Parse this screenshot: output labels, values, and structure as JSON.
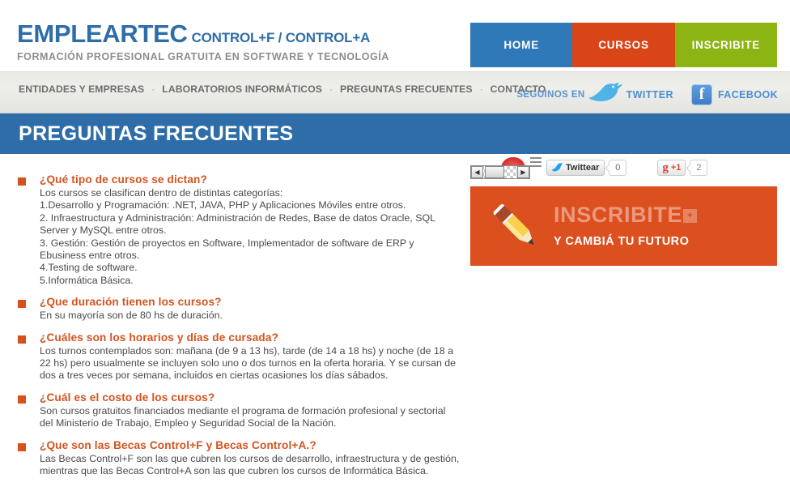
{
  "header": {
    "brand_main": "EMPLEARTEC",
    "brand_sub": "CONTROL+F / CONTROL+A",
    "tagline": "FORMACIÓN PROFESIONAL GRATUITA EN SOFTWARE Y TECNOLOGÍA",
    "nav": [
      {
        "label": "HOME",
        "color": "#3079b8"
      },
      {
        "label": "CURSOS",
        "color": "#da4518"
      },
      {
        "label": "INSCRIBITE",
        "color": "#8cb513"
      }
    ]
  },
  "subnav": {
    "links": [
      "ENTIDADES Y EMPRESAS",
      "LABORATORIOS INFORMÁTICOS",
      "PREGUNTAS FRECUENTES",
      "CONTACTO"
    ],
    "separator": "·",
    "social": {
      "follow_label": "SEGUINOS EN",
      "twitter_label": "TWITTER",
      "facebook_label": "FACEBOOK",
      "facebook_glyph": "f"
    }
  },
  "page": {
    "title": "PREGUNTAS FRECUENTES",
    "title_bar_color": "#2e6da8"
  },
  "faq": {
    "accent_color": "#d5521d",
    "items": [
      {
        "question": "¿Qué tipo de cursos se dictan?",
        "answer": "Los cursos se clasifican dentro de distintas categorías:\n1.Desarrollo y Programación: .NET, JAVA, PHP y Aplicaciones Móviles entre otros.\n2. Infraestructura y Administración: Administración de Redes, Base de datos Oracle, SQL Server y MySQL entre otros.\n3. Gestión: Gestión de proyectos en Software, Implementador de software de ERP y Ebusiness entre otros.\n4.Testing de software.\n5.Informática Básica."
      },
      {
        "question": "¿Que duración tienen los cursos?",
        "answer": "En su mayoría son de 80 hs de duración."
      },
      {
        "question": "¿Cuáles son los horarios y días de cursada?",
        "answer": "Los turnos contemplados son: mañana (de 9 a 13 hs), tarde (de 14 a 18 hs) y noche (de 18 a 22 hs) pero usualmente se incluyen solo uno o dos turnos en la oferta horaria. Y se cursan de dos a tres veces por semana, incluidos en ciertas ocasiones los días sábados."
      },
      {
        "question": "¿Cuál es el costo de los cursos?",
        "answer": "Son cursos gratuitos financiados mediante el programa de formación profesional y sectorial del Ministerio de Trabajo, Empleo y Seguridad Social de la Nación."
      },
      {
        "question": "¿Que son las Becas Control+F y Becas Control+A.?",
        "answer": "Las Becas Control+F son las que cubren los cursos de desarrollo, infraestructura y de gestión, mientras que las Becas Control+A son las que cubren los cursos de Informática Básica."
      }
    ]
  },
  "sidebar": {
    "share": {
      "twitter_button_label": "Twittear",
      "twitter_count": "0",
      "gplus_g": "g",
      "gplus_label": "+1",
      "gplus_count": "2",
      "scroll_left_arrow": "◀",
      "scroll_right_arrow": "▶"
    },
    "promo": {
      "title": "INSCRIBITE",
      "plus_label": "+",
      "subtitle": "Y CAMBIÁ TU FUTURO",
      "background_color": "#dc4f1e"
    }
  }
}
